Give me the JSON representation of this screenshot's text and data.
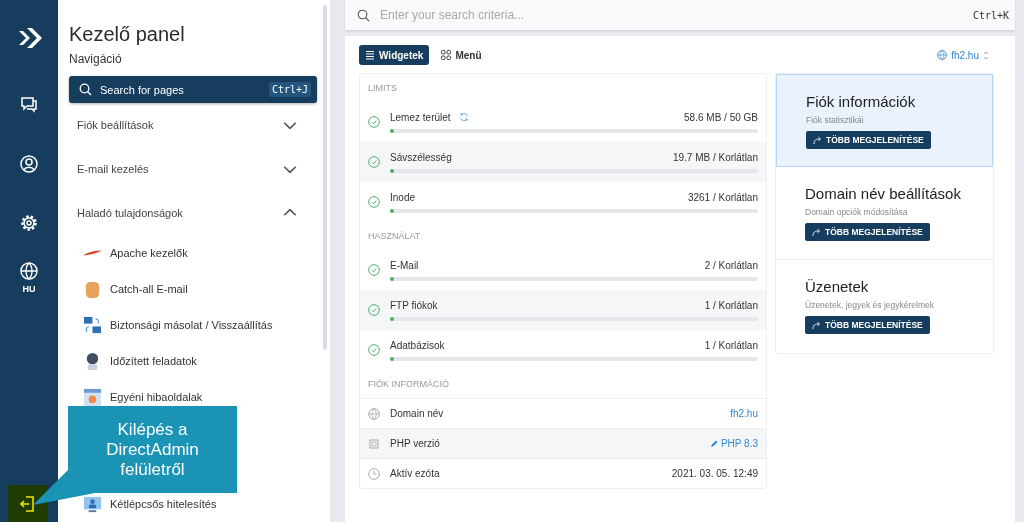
{
  "rail": {
    "language": "HU"
  },
  "nav": {
    "title": "Kezelő panel",
    "subtitle": "Navigáció",
    "search": {
      "placeholder": "Search for pages",
      "shortcut": "Ctrl+J"
    },
    "sections": [
      {
        "label": "Fiók beállítások",
        "expanded": false
      },
      {
        "label": "E-mail kezelés",
        "expanded": false
      },
      {
        "label": "Haladó tulajdonságok",
        "expanded": true
      }
    ],
    "items": [
      "Apache kezelők",
      "Catch-all E-mail",
      "Biztonsági másolat / Visszaállítás",
      "Időzített feladatok",
      "Egyéni hibaoldalak",
      "Kétlépcsős hitelesítés"
    ]
  },
  "tooltip": "Kilépés a DirectAdmin felületről",
  "search": {
    "placeholder": "Enter your search criteria...",
    "shortcut": "Ctrl+K"
  },
  "view_tabs": [
    {
      "label": "Widgetek",
      "selected": true
    },
    {
      "label": "Menü",
      "selected": false
    }
  ],
  "domain_selector": "fh2.hu",
  "groups": [
    {
      "title": "LIMITS",
      "rows": [
        {
          "label": "Lemez terület",
          "value": "58.6 MB / 50 GB",
          "ok": true,
          "refresh": true,
          "level": 0.01
        },
        {
          "label": "Sávszélesség",
          "value": "19.7 MB / Korlátlan",
          "ok": true,
          "refresh": false,
          "level": 0.01
        },
        {
          "label": "Inode",
          "value": "3261 / Korlátlan",
          "ok": true,
          "refresh": false,
          "level": 0.01
        }
      ]
    },
    {
      "title": "HASZNÁLAT",
      "rows": [
        {
          "label": "E-Mail",
          "value": "2 / Korlátlan",
          "ok": true,
          "refresh": false,
          "level": 0.01
        },
        {
          "label": "FTP fiókok",
          "value": "1 / Korlátlan",
          "ok": true,
          "refresh": false,
          "level": 0.01
        },
        {
          "label": "Adatbázisok",
          "value": "1 / Korlátlan",
          "ok": true,
          "refresh": false,
          "level": 0.01
        }
      ]
    }
  ],
  "info": {
    "title": "FIÓK INFORMÁCIÓ",
    "rows": [
      {
        "kind": "link",
        "label": "Domain név",
        "value": "fh2.hu"
      },
      {
        "kind": "edit",
        "label": "PHP verzió",
        "value": "PHP 8.3"
      },
      {
        "kind": "text",
        "label": "Aktív ezóta",
        "value": "2021. 03. 05. 12:49"
      }
    ]
  },
  "cards": [
    {
      "title": "Fiók információk",
      "subtitle": "Fiók statisztikái",
      "button": "TÖBB MEGJELENÍTÉSE",
      "selected": true
    },
    {
      "title": "Domain név beállítások",
      "subtitle": "Domain opciók módosítása",
      "button": "TÖBB MEGJELENÍTÉSE",
      "selected": false
    },
    {
      "title": "Üzenetek",
      "subtitle": "Üzenetek, jegyek és jegykérelmek",
      "button": "TÖBB MEGJELENÍTÉSE",
      "selected": false
    }
  ]
}
